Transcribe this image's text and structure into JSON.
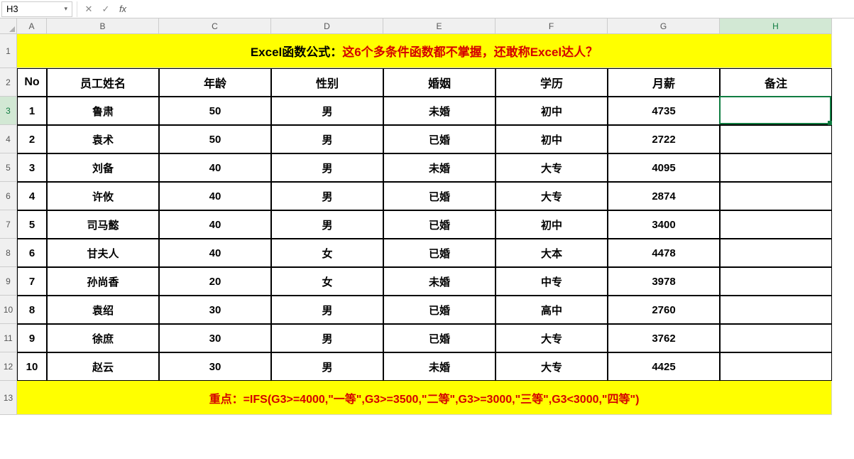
{
  "formulaBar": {
    "nameBox": "H3",
    "fx": "fx",
    "input": ""
  },
  "columns": [
    "A",
    "B",
    "C",
    "D",
    "E",
    "F",
    "G",
    "H"
  ],
  "rowNumbers": [
    "1",
    "2",
    "3",
    "4",
    "5",
    "6",
    "7",
    "8",
    "9",
    "10",
    "11",
    "12",
    "13"
  ],
  "banner": {
    "prefix": "Excel函数公式：",
    "rest": "这6个多条件函数都不掌握，还敢称Excel达人？"
  },
  "headers": [
    "No",
    "员工姓名",
    "年龄",
    "性别",
    "婚姻",
    "学历",
    "月薪",
    "备注"
  ],
  "rows": [
    {
      "no": "1",
      "name": "鲁肃",
      "age": "50",
      "sex": "男",
      "marital": "未婚",
      "edu": "初中",
      "salary": "4735",
      "note": ""
    },
    {
      "no": "2",
      "name": "袁术",
      "age": "50",
      "sex": "男",
      "marital": "已婚",
      "edu": "初中",
      "salary": "2722",
      "note": ""
    },
    {
      "no": "3",
      "name": "刘备",
      "age": "40",
      "sex": "男",
      "marital": "未婚",
      "edu": "大专",
      "salary": "4095",
      "note": ""
    },
    {
      "no": "4",
      "name": "许攸",
      "age": "40",
      "sex": "男",
      "marital": "已婚",
      "edu": "大专",
      "salary": "2874",
      "note": ""
    },
    {
      "no": "5",
      "name": "司马懿",
      "age": "40",
      "sex": "男",
      "marital": "已婚",
      "edu": "初中",
      "salary": "3400",
      "note": ""
    },
    {
      "no": "6",
      "name": "甘夫人",
      "age": "40",
      "sex": "女",
      "marital": "已婚",
      "edu": "大本",
      "salary": "4478",
      "note": ""
    },
    {
      "no": "7",
      "name": "孙尚香",
      "age": "20",
      "sex": "女",
      "marital": "未婚",
      "edu": "中专",
      "salary": "3978",
      "note": ""
    },
    {
      "no": "8",
      "name": "袁绍",
      "age": "30",
      "sex": "男",
      "marital": "已婚",
      "edu": "高中",
      "salary": "2760",
      "note": ""
    },
    {
      "no": "9",
      "name": "徐庶",
      "age": "30",
      "sex": "男",
      "marital": "已婚",
      "edu": "大专",
      "salary": "3762",
      "note": ""
    },
    {
      "no": "10",
      "name": "赵云",
      "age": "30",
      "sex": "男",
      "marital": "未婚",
      "edu": "大专",
      "salary": "4425",
      "note": ""
    }
  ],
  "footer": {
    "label": "重点：",
    "formula": "=IFS(G3>=4000,\"一等\",G3>=3500,\"二等\",G3>=3000,\"三等\",G3<3000,\"四等\")"
  },
  "activeCell": "H3"
}
